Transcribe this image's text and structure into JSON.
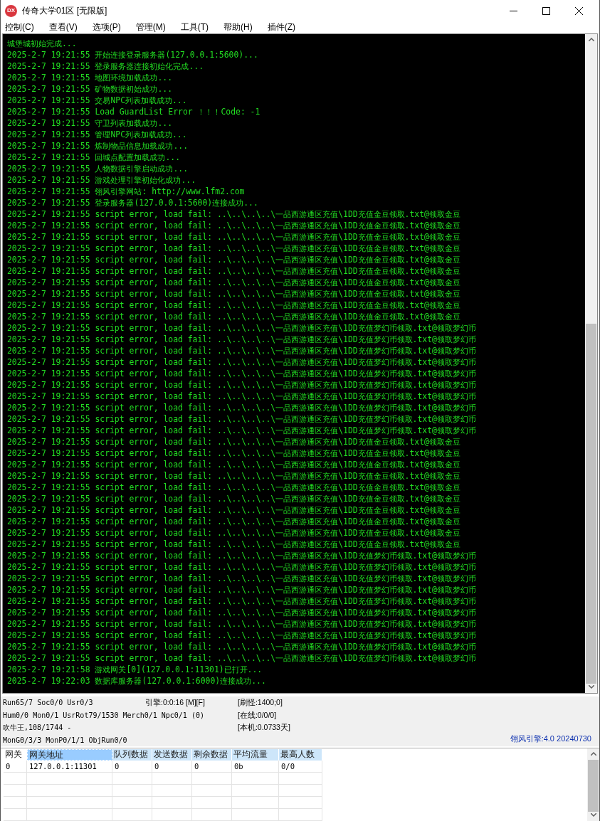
{
  "window": {
    "title": "传奇大学01区 [无限版]",
    "app_badge": "DX"
  },
  "menu": [
    "控制(C)",
    "查看(V)",
    "选项(P)",
    "管理(M)",
    "工具(T)",
    "帮助(H)",
    "插件(Z)"
  ],
  "log": [
    "城堡城初始完成...",
    "2025-2-7 19:21:55 开始连接登录服务器(127.0.0.1:5600)...",
    "2025-2-7 19:21:55 登录服务器连接初始化完成...",
    "2025-2-7 19:21:55 地图环境加载成功...",
    "2025-2-7 19:21:55 矿物数据初始成功...",
    "2025-2-7 19:21:55 交易NPC列表加载成功...",
    "2025-2-7 19:21:55 Load GuardList Error ！！！Code: -1",
    "2025-2-7 19:21:55 守卫列表加载成功...",
    "2025-2-7 19:21:55 管理NPC列表加载成功...",
    "2025-2-7 19:21:55 炼制物品信息加载成功...",
    "2025-2-7 19:21:55 回城点配置加载成功...",
    "2025-2-7 19:21:55 人物数据引擎启动成功...",
    "2025-2-7 19:21:55 游戏处理引擎初始化成功...",
    "2025-2-7 19:21:55 翎风引擎网站: http://www.lfm2.com",
    "2025-2-7 19:21:55 登录服务器(127.0.0.1:5600)连接成功...",
    "2025-2-7 19:21:55 script error, load fail: ..\\..\\..\\..\\一品西游通区充值\\1DD充值金豆领取.txt@领取金豆",
    "2025-2-7 19:21:55 script error, load fail: ..\\..\\..\\..\\一品西游通区充值\\1DD充值金豆领取.txt@领取金豆",
    "2025-2-7 19:21:55 script error, load fail: ..\\..\\..\\..\\一品西游通区充值\\1DD充值金豆领取.txt@领取金豆",
    "2025-2-7 19:21:55 script error, load fail: ..\\..\\..\\..\\一品西游通区充值\\1DD充值金豆领取.txt@领取金豆",
    "2025-2-7 19:21:55 script error, load fail: ..\\..\\..\\..\\一品西游通区充值\\1DD充值金豆领取.txt@领取金豆",
    "2025-2-7 19:21:55 script error, load fail: ..\\..\\..\\..\\一品西游通区充值\\1DD充值金豆领取.txt@领取金豆",
    "2025-2-7 19:21:55 script error, load fail: ..\\..\\..\\..\\一品西游通区充值\\1DD充值金豆领取.txt@领取金豆",
    "2025-2-7 19:21:55 script error, load fail: ..\\..\\..\\..\\一品西游通区充值\\1DD充值金豆领取.txt@领取金豆",
    "2025-2-7 19:21:55 script error, load fail: ..\\..\\..\\..\\一品西游通区充值\\1DD充值金豆领取.txt@领取金豆",
    "2025-2-7 19:21:55 script error, load fail: ..\\..\\..\\..\\一品西游通区充值\\1DD充值金豆领取.txt@领取金豆",
    "2025-2-7 19:21:55 script error, load fail: ..\\..\\..\\..\\一品西游通区充值\\1DD充值梦幻币领取.txt@领取梦幻币",
    "2025-2-7 19:21:55 script error, load fail: ..\\..\\..\\..\\一品西游通区充值\\1DD充值梦幻币领取.txt@领取梦幻币",
    "2025-2-7 19:21:55 script error, load fail: ..\\..\\..\\..\\一品西游通区充值\\1DD充值梦幻币领取.txt@领取梦幻币",
    "2025-2-7 19:21:55 script error, load fail: ..\\..\\..\\..\\一品西游通区充值\\1DD充值梦幻币领取.txt@领取梦幻币",
    "2025-2-7 19:21:55 script error, load fail: ..\\..\\..\\..\\一品西游通区充值\\1DD充值梦幻币领取.txt@领取梦幻币",
    "2025-2-7 19:21:55 script error, load fail: ..\\..\\..\\..\\一品西游通区充值\\1DD充值梦幻币领取.txt@领取梦幻币",
    "2025-2-7 19:21:55 script error, load fail: ..\\..\\..\\..\\一品西游通区充值\\1DD充值梦幻币领取.txt@领取梦幻币",
    "2025-2-7 19:21:55 script error, load fail: ..\\..\\..\\..\\一品西游通区充值\\1DD充值梦幻币领取.txt@领取梦幻币",
    "2025-2-7 19:21:55 script error, load fail: ..\\..\\..\\..\\一品西游通区充值\\1DD充值梦幻币领取.txt@领取梦幻币",
    "2025-2-7 19:21:55 script error, load fail: ..\\..\\..\\..\\一品西游通区充值\\1DD充值梦幻币领取.txt@领取梦幻币",
    "2025-2-7 19:21:55 script error, load fail: ..\\..\\..\\..\\一品西游通区充值\\1DD充值金豆领取.txt@领取金豆",
    "2025-2-7 19:21:55 script error, load fail: ..\\..\\..\\..\\一品西游通区充值\\1DD充值金豆领取.txt@领取金豆",
    "2025-2-7 19:21:55 script error, load fail: ..\\..\\..\\..\\一品西游通区充值\\1DD充值金豆领取.txt@领取金豆",
    "2025-2-7 19:21:55 script error, load fail: ..\\..\\..\\..\\一品西游通区充值\\1DD充值金豆领取.txt@领取金豆",
    "2025-2-7 19:21:55 script error, load fail: ..\\..\\..\\..\\一品西游通区充值\\1DD充值金豆领取.txt@领取金豆",
    "2025-2-7 19:21:55 script error, load fail: ..\\..\\..\\..\\一品西游通区充值\\1DD充值金豆领取.txt@领取金豆",
    "2025-2-7 19:21:55 script error, load fail: ..\\..\\..\\..\\一品西游通区充值\\1DD充值金豆领取.txt@领取金豆",
    "2025-2-7 19:21:55 script error, load fail: ..\\..\\..\\..\\一品西游通区充值\\1DD充值金豆领取.txt@领取金豆",
    "2025-2-7 19:21:55 script error, load fail: ..\\..\\..\\..\\一品西游通区充值\\1DD充值金豆领取.txt@领取金豆",
    "2025-2-7 19:21:55 script error, load fail: ..\\..\\..\\..\\一品西游通区充值\\1DD充值金豆领取.txt@领取金豆",
    "2025-2-7 19:21:55 script error, load fail: ..\\..\\..\\..\\一品西游通区充值\\1DD充值梦幻币领取.txt@领取梦幻币",
    "2025-2-7 19:21:55 script error, load fail: ..\\..\\..\\..\\一品西游通区充值\\1DD充值梦幻币领取.txt@领取梦幻币",
    "2025-2-7 19:21:55 script error, load fail: ..\\..\\..\\..\\一品西游通区充值\\1DD充值梦幻币领取.txt@领取梦幻币",
    "2025-2-7 19:21:55 script error, load fail: ..\\..\\..\\..\\一品西游通区充值\\1DD充值梦幻币领取.txt@领取梦幻币",
    "2025-2-7 19:21:55 script error, load fail: ..\\..\\..\\..\\一品西游通区充值\\1DD充值梦幻币领取.txt@领取梦幻币",
    "2025-2-7 19:21:55 script error, load fail: ..\\..\\..\\..\\一品西游通区充值\\1DD充值梦幻币领取.txt@领取梦幻币",
    "2025-2-7 19:21:55 script error, load fail: ..\\..\\..\\..\\一品西游通区充值\\1DD充值梦幻币领取.txt@领取梦幻币",
    "2025-2-7 19:21:55 script error, load fail: ..\\..\\..\\..\\一品西游通区充值\\1DD充值梦幻币领取.txt@领取梦幻币",
    "2025-2-7 19:21:55 script error, load fail: ..\\..\\..\\..\\一品西游通区充值\\1DD充值梦幻币领取.txt@领取梦幻币",
    "2025-2-7 19:21:55 script error, load fail: ..\\..\\..\\..\\一品西游通区充值\\1DD充值梦幻币领取.txt@领取梦幻币",
    "2025-2-7 19:21:58 游戏网关[0](127.0.0.1:11301)已打开...",
    "2025-2-7 19:22:03 数据库服务器(127.0.0.1:6000)连接成功..."
  ],
  "status": {
    "rows": [
      [
        "Run65/7 Soc0/0 Usr0/3",
        "引擎:0:0:16 [M][F]",
        "[刷怪:1400;0]"
      ],
      [
        "Hum0/0 Mon0/1 UsrRot79/1530 Merch0/1 Npc0/1 (0)",
        "",
        "[在线:0/0/0]"
      ],
      [
        "吹牛王,108/1744 -",
        "",
        "[本机:0.0733天]"
      ],
      [
        "MonG0/3/3 MonP0/1/1 ObjRun0/0",
        "",
        ""
      ]
    ],
    "version": "翎风引擎:4.0 20240730"
  },
  "table": {
    "columns": [
      {
        "label": "网关",
        "selected": false
      },
      {
        "label": "网关地址",
        "selected": true
      },
      {
        "label": "队列数据",
        "selected": false
      },
      {
        "label": "发送数据",
        "selected": false
      },
      {
        "label": "剩余数据",
        "selected": false
      },
      {
        "label": "平均流量",
        "selected": false
      },
      {
        "label": "最高人数",
        "selected": false
      }
    ],
    "rows": [
      [
        "0",
        "127.0.0.1:11301",
        "0",
        "0",
        "0",
        "0b",
        "0/0"
      ]
    ]
  }
}
